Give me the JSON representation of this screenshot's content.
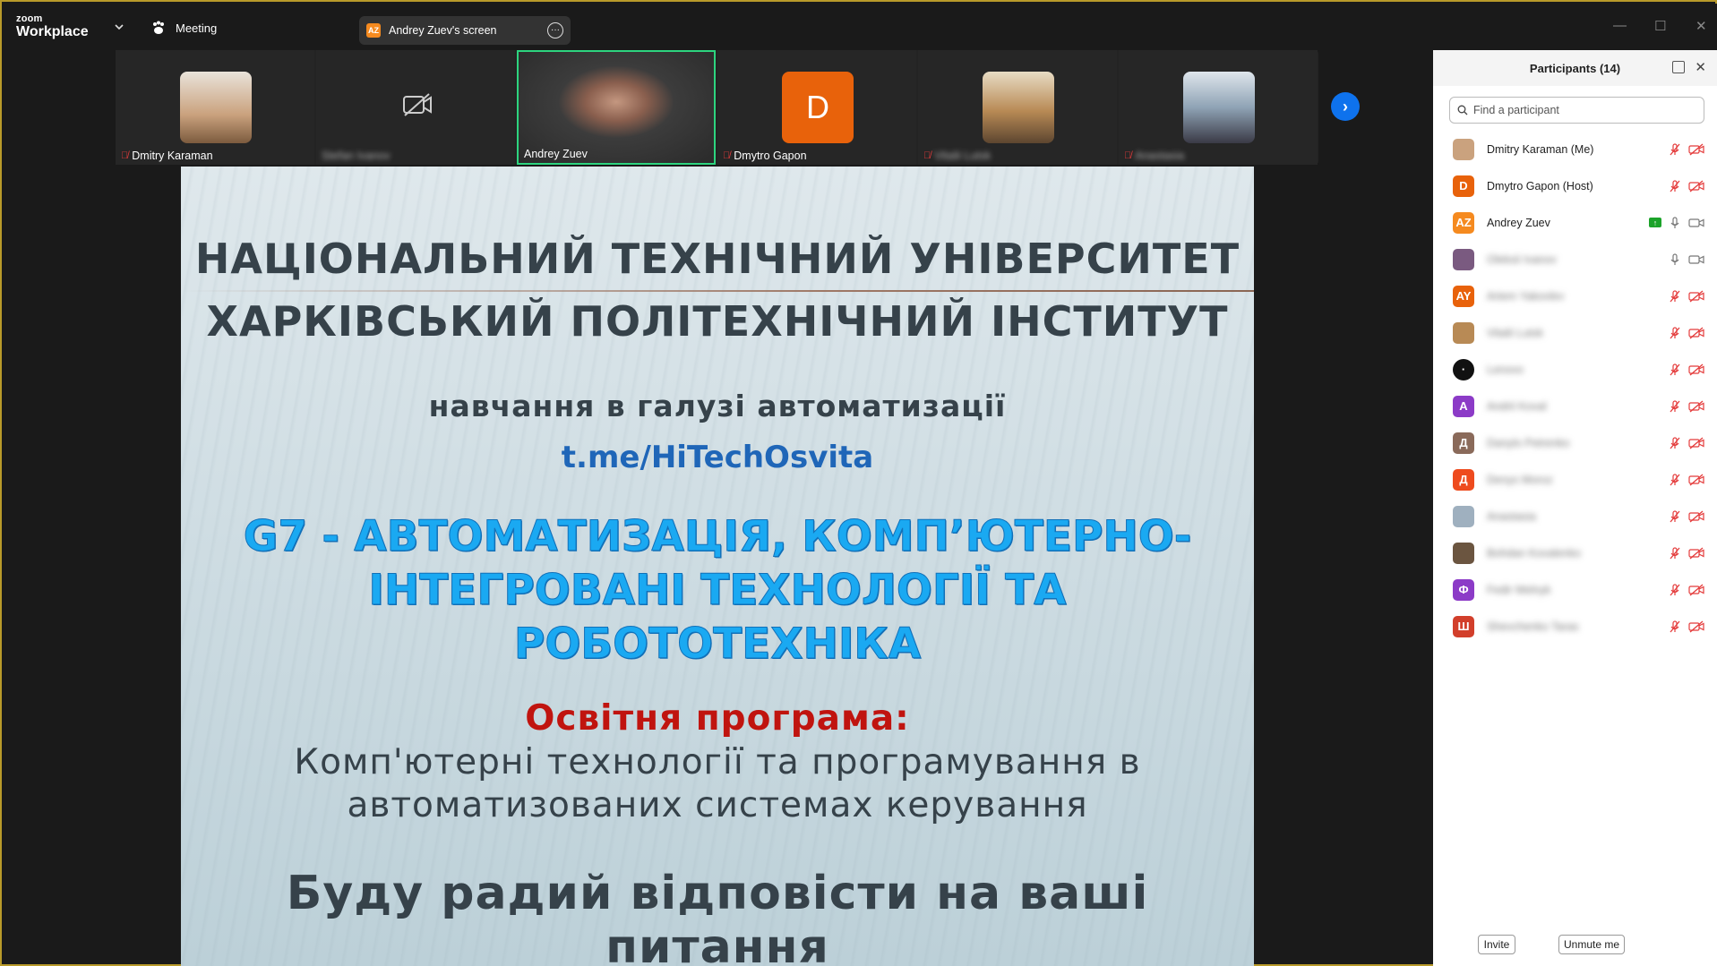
{
  "app": {
    "logo_small": "zoom",
    "logo_big": "Workplace",
    "meeting_label": "Meeting"
  },
  "screen_share": {
    "badge": "AZ",
    "label": "Andrey Zuev's screen"
  },
  "video_strip": [
    {
      "name": "Dmitry Karaman",
      "muted": true,
      "blurred": false,
      "type": "photo",
      "color": "#caa27e"
    },
    {
      "name": "Stefan Ivanov",
      "muted": false,
      "blurred": true,
      "type": "video-off",
      "color": "#262626"
    },
    {
      "name": "Andrey Zuev",
      "muted": false,
      "blurred": false,
      "type": "active",
      "color": "#4a4a4a"
    },
    {
      "name": "Dmytro Gapon",
      "muted": true,
      "blurred": false,
      "type": "letter",
      "letter": "D",
      "color": "#e8620b"
    },
    {
      "name": "Vitalii Lutsk",
      "muted": true,
      "blurred": true,
      "type": "photo",
      "color": "#b88a55"
    },
    {
      "name": "Anastasia",
      "muted": true,
      "blurred": true,
      "type": "photo",
      "color": "#8fa3b5"
    }
  ],
  "slide": {
    "line1": "НАЦІОНАЛЬНИЙ ТЕХНІЧНИЙ УНІВЕРСИТЕТ",
    "line2": "ХАРКІВСЬКИЙ ПОЛІТЕХНІЧНИЙ ІНСТИТУТ",
    "line3": "навчання в галузі автоматизації",
    "link": "t.me/HiTechOsvita",
    "g7_line1": "G7 - АВТОМАТИЗАЦІЯ, КОМП’ЮТЕРНО-",
    "g7_line2": "ІНТЕГРОВАНІ ТЕХНОЛОГІЇ ТА",
    "g7_line3": "РОБОТОТЕХНІКА",
    "program_title": "Освітня програма:",
    "program_line1": "Комп'ютерні технології та програмування в",
    "program_line2": "автоматизованих системах керування",
    "closing": "Буду радий відповісти на ваші питання"
  },
  "participants": {
    "title": "Participants (14)",
    "search_placeholder": "Find a participant",
    "items": [
      {
        "name": "Dmitry Karaman (Me)",
        "avatar": "",
        "avatar_color": "#caa27e",
        "blurred": false,
        "mic": "off",
        "cam": "off"
      },
      {
        "name": "Dmytro Gapon (Host)",
        "avatar": "D",
        "avatar_color": "#e8620b",
        "blurred": false,
        "mic": "off",
        "cam": "off"
      },
      {
        "name": "Andrey Zuev",
        "avatar": "AZ",
        "avatar_color": "#f58a1f",
        "blurred": false,
        "mic": "on",
        "cam": "on",
        "sharing": true
      },
      {
        "name": "Oleksii Ivanov",
        "avatar": "",
        "avatar_color": "#7a5a80",
        "blurred": true,
        "mic": "on",
        "cam": "on"
      },
      {
        "name": "Artem Yakovlev",
        "avatar": "AY",
        "avatar_color": "#e8620b",
        "blurred": true,
        "mic": "off",
        "cam": "off"
      },
      {
        "name": "Vitalii Lutsk",
        "avatar": "",
        "avatar_color": "#b88a55",
        "blurred": true,
        "mic": "off",
        "cam": "off"
      },
      {
        "name": "Lenovo",
        "avatar": "·",
        "avatar_color": "#111111",
        "blurred": true,
        "mic": "off",
        "cam": "off"
      },
      {
        "name": "Andrii Koval",
        "avatar": "A",
        "avatar_color": "#8c3bc7",
        "blurred": true,
        "mic": "off",
        "cam": "off"
      },
      {
        "name": "Danylo Petrenko",
        "avatar": "Д",
        "avatar_color": "#8a6a5a",
        "blurred": true,
        "mic": "off",
        "cam": "off"
      },
      {
        "name": "Denys Moroz",
        "avatar": "Д",
        "avatar_color": "#ee4b1e",
        "blurred": true,
        "mic": "off",
        "cam": "off"
      },
      {
        "name": "Anastasia",
        "avatar": "",
        "avatar_color": "#9fb0bf",
        "blurred": true,
        "mic": "off",
        "cam": "off"
      },
      {
        "name": "Bohdan Kovalenko",
        "avatar": "",
        "avatar_color": "#6b5540",
        "blurred": true,
        "mic": "off",
        "cam": "off"
      },
      {
        "name": "Fedir Melnyk",
        "avatar": "Ф",
        "avatar_color": "#8c3bc7",
        "blurred": true,
        "mic": "off",
        "cam": "off"
      },
      {
        "name": "Shevchenko Taras",
        "avatar": "Ш",
        "avatar_color": "#d23f2b",
        "blurred": true,
        "mic": "off",
        "cam": "off"
      }
    ],
    "invite_label": "Invite",
    "unmute_label": "Unmute me"
  }
}
